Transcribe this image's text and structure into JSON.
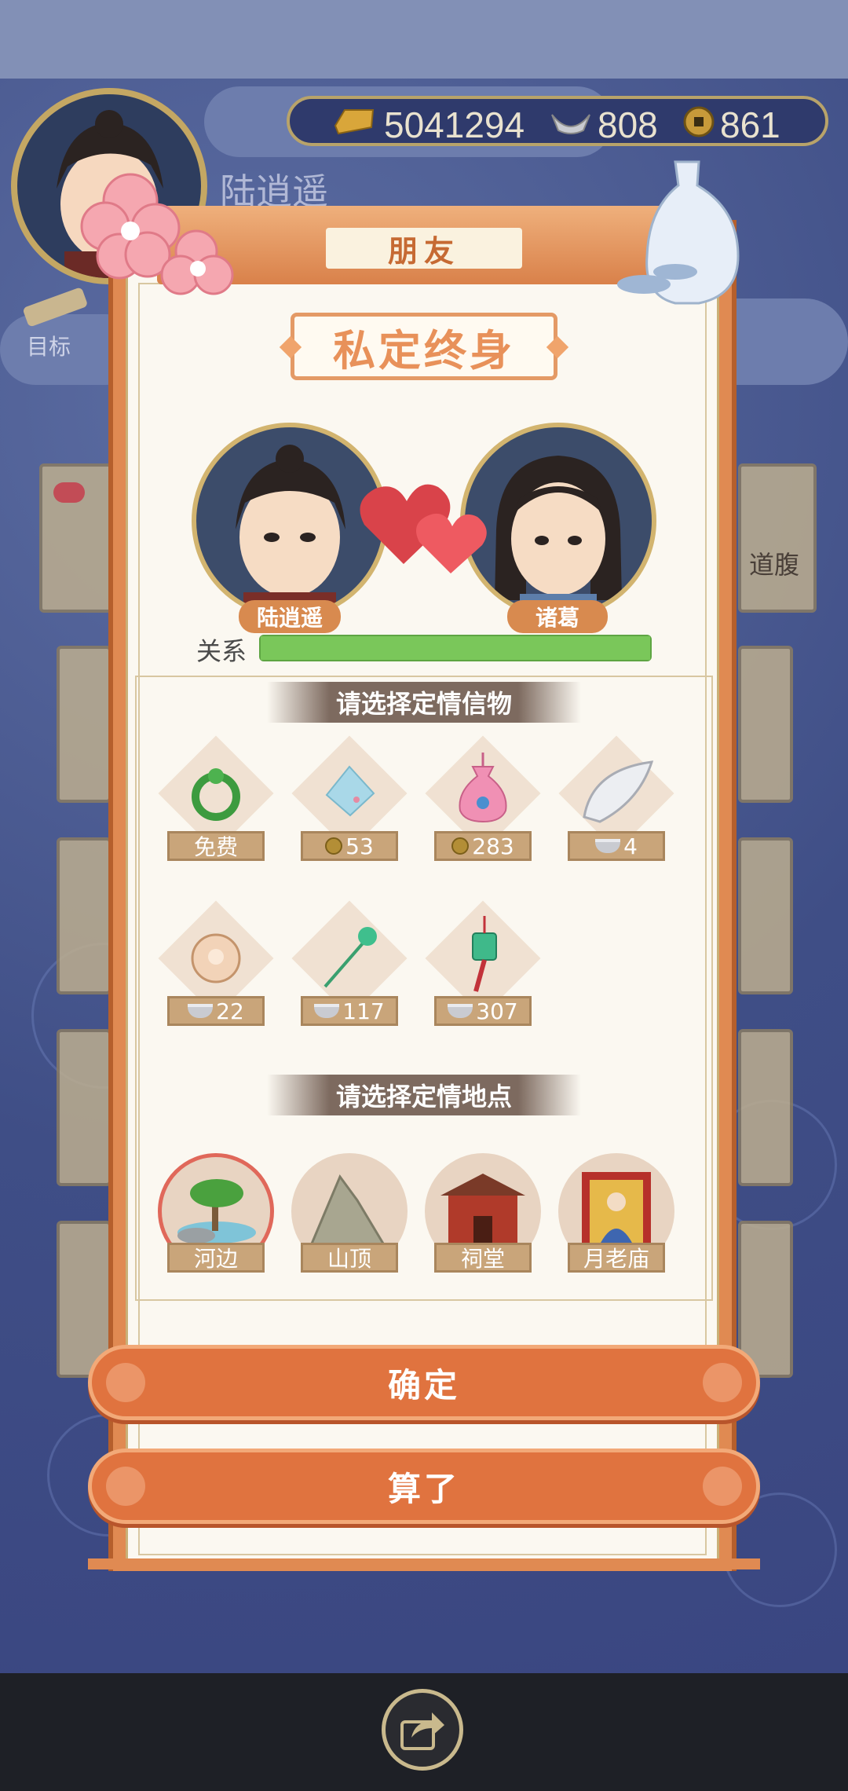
{
  "header": {
    "player_name": "陆逍遥",
    "goal_label": "目标",
    "gold": "5041294",
    "silver": "808",
    "coins": "861"
  },
  "dialog": {
    "tab_title": "朋友",
    "title": "私定终身",
    "left_name": "陆逍遥",
    "right_name": "诸葛",
    "relation_label": "关系",
    "relation_progress": 1.0,
    "gifts_heading": "请选择定情信物",
    "gifts": [
      {
        "name": "green-bracelet",
        "price": "免费",
        "currency": "none"
      },
      {
        "name": "handkerchief",
        "price": "53",
        "currency": "coin"
      },
      {
        "name": "sachet",
        "price": "283",
        "currency": "coin"
      },
      {
        "name": "comb",
        "price": "4",
        "currency": "silver"
      },
      {
        "name": "jade-pendant",
        "price": "22",
        "currency": "silver"
      },
      {
        "name": "hairpin",
        "price": "117",
        "currency": "silver"
      },
      {
        "name": "jade-tassel",
        "price": "307",
        "currency": "silver"
      }
    ],
    "places_heading": "请选择定情地点",
    "places": [
      {
        "label": "河边",
        "selected": true
      },
      {
        "label": "山顶",
        "selected": false
      },
      {
        "label": "祠堂",
        "selected": false
      },
      {
        "label": "月老庙",
        "selected": false
      }
    ],
    "confirm_label": "确定",
    "cancel_label": "算了"
  },
  "background_hint": "道腹",
  "colors": {
    "accent": "#e0733f",
    "progress": "#7ac75a",
    "selected_ring": "#e0685a"
  }
}
